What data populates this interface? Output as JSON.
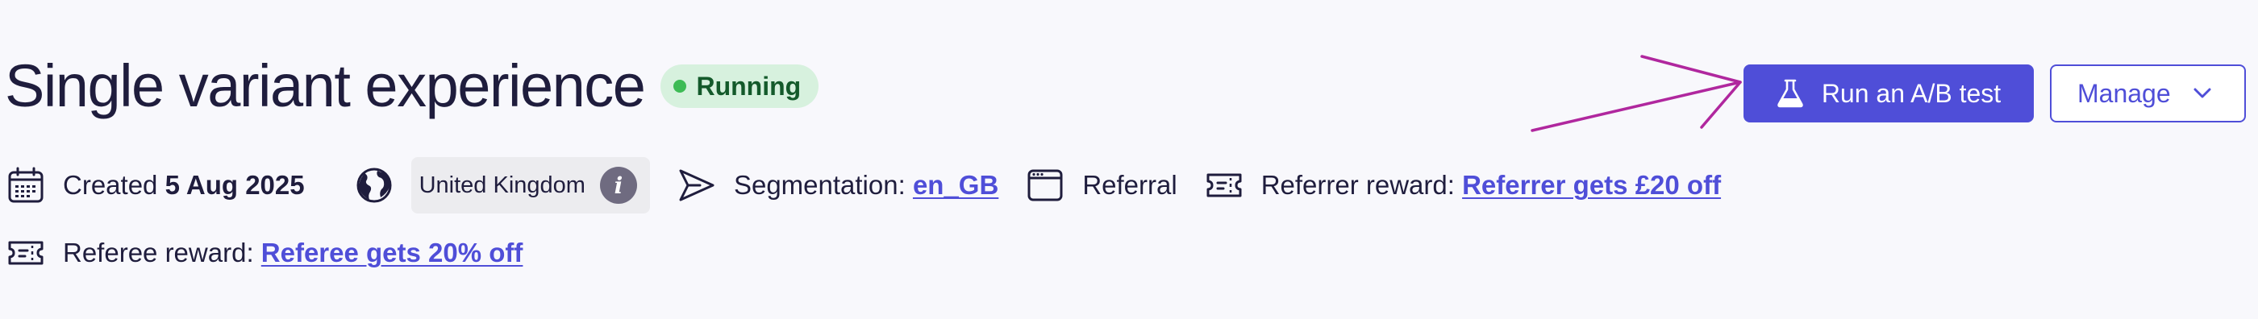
{
  "header": {
    "title": "Single variant experience",
    "status": "Running",
    "status_color": "#3dbb55",
    "primary_button": {
      "label": "Run an A/B test",
      "icon": "flask-icon"
    },
    "secondary_button": {
      "label": "Manage",
      "icon": "chevron-down-icon"
    },
    "accent_color": "#4f4ed8",
    "annotation_color": "#b0279e"
  },
  "meta": {
    "created": {
      "icon": "calendar-icon",
      "prefix": "Created",
      "date": "5 Aug 2025"
    },
    "region": {
      "icon": "globe-icon",
      "label": "United Kingdom",
      "info_icon": "info-icon"
    },
    "segmentation": {
      "icon": "send-icon",
      "label": "Segmentation:",
      "value": "en_GB"
    },
    "channel": {
      "icon": "window-icon",
      "label": "Referral"
    },
    "referrer_reward": {
      "icon": "ticket-icon",
      "label": "Referrer reward:",
      "value": "Referrer gets £20 off"
    },
    "referee_reward": {
      "icon": "ticket-icon",
      "label": "Referee reward:",
      "value": "Referee gets 20% off"
    }
  }
}
